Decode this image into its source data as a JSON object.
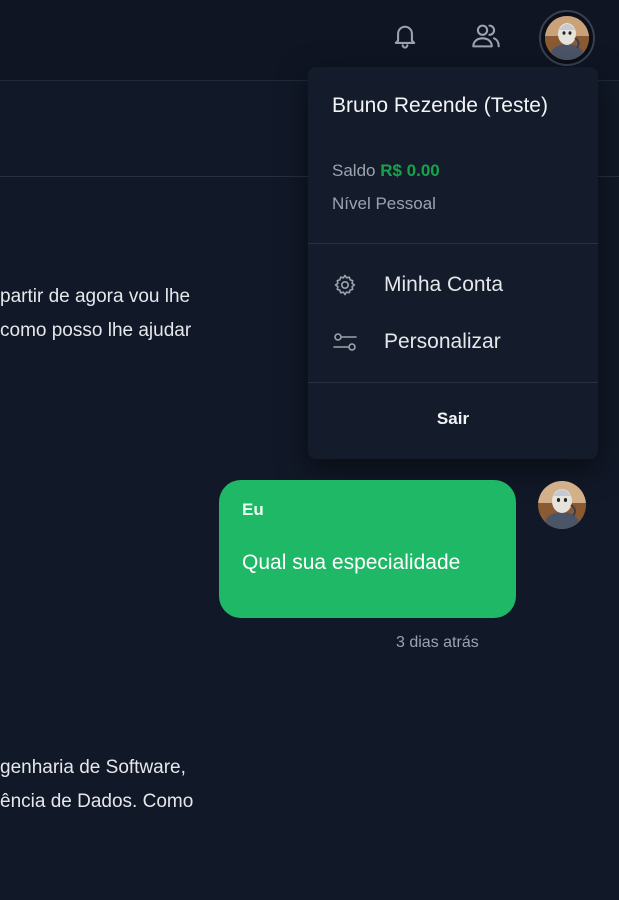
{
  "user": {
    "name": "Bruno Rezende (Teste)",
    "balance_label": "Saldo",
    "balance_value": "R$ 0.00",
    "level": "Nível Pessoal"
  },
  "topbar": {
    "icons": [
      "bell-icon",
      "users-icon",
      "avatar"
    ]
  },
  "menu": {
    "items": [
      {
        "label": "Minha Conta",
        "icon": "gear-icon"
      },
      {
        "label": "Personalizar",
        "icon": "sliders-icon"
      }
    ],
    "logout_label": "Sair"
  },
  "conversation": {
    "assistant_message_1": [
      "partir de agora vou lhe",
      "como posso lhe ajudar"
    ],
    "user_message": {
      "author": "Eu",
      "text": "Qual sua especialidade",
      "timestamp": "3 dias atrás"
    },
    "assistant_message_2": [
      "genharia de Software,",
      "ência de Dados. Como"
    ]
  },
  "colors": {
    "background": "#111827",
    "bubble": "#1fb866",
    "balance": "#16a34a"
  }
}
